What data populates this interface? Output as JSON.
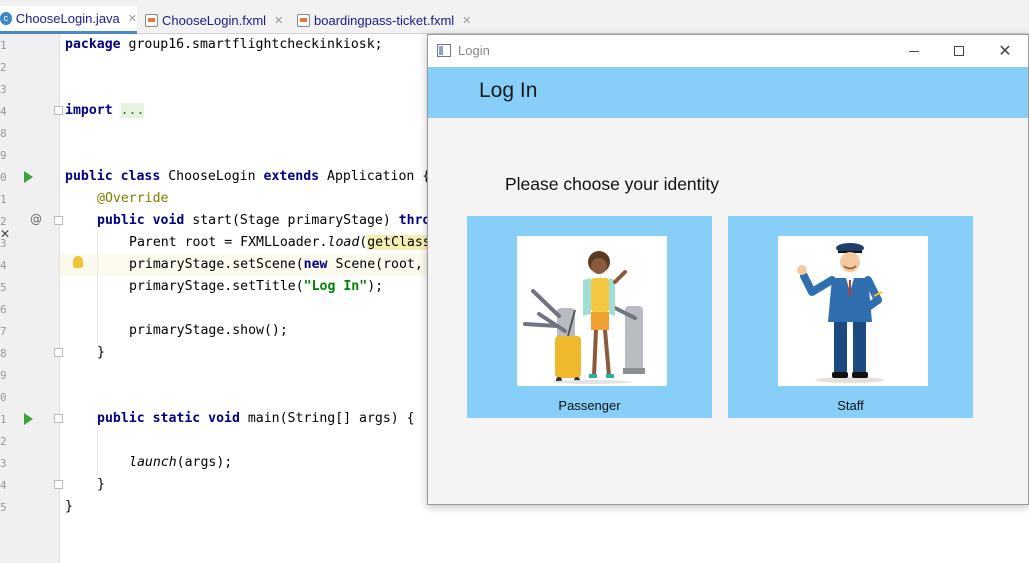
{
  "editor": {
    "tabs": [
      {
        "label": "ChooseLogin.java",
        "icon": "java-file-icon",
        "active": true
      },
      {
        "label": "ChooseLogin.fxml",
        "icon": "fxml-file-icon",
        "active": false
      },
      {
        "label": "boardingpass-ticket.fxml",
        "icon": "fxml-file-icon",
        "active": false
      }
    ],
    "line_numbers": [
      "1",
      "2",
      "3",
      "4",
      "8",
      "9",
      "0",
      "1",
      "2",
      "3",
      "4",
      "5",
      "6",
      "7",
      "8",
      "9",
      "0",
      "1",
      "2",
      "3",
      "4",
      "5"
    ],
    "code": {
      "package_kw": "package",
      "package_name": " group16.smartflightcheckinkiosk;",
      "import_kw": "import",
      "import_fold": "...",
      "class_line_kw1": "public class",
      "class_name": " ChooseLogin ",
      "class_extends": "extends",
      "class_rest": " Application {",
      "override": "@Override",
      "start_kw": "public void",
      "start_sig": " start(Stage primaryStage) ",
      "start_throws": "thro",
      "root_line_a": "Parent root = FXMLLoader.",
      "root_line_load": "load",
      "root_line_b": "(",
      "root_line_hl": "getClass",
      "scene_line_a": "primaryStage.setScene(",
      "scene_new": "new",
      "scene_line_b": " Scene(root,",
      "title_line_a": "primaryStage.setTitle(",
      "title_str": "\"Log In\"",
      "title_line_b": ");",
      "show_line": "primaryStage.show();",
      "close_brace_inner": "}",
      "main_kw": "public static void",
      "main_sig": " main(String[] args) {",
      "launch_call": "launch",
      "launch_rest": "(args);",
      "close_brace_main": "}",
      "close_brace_class": "}"
    }
  },
  "login_window": {
    "title": "Login",
    "header_title": "Log In",
    "prompt": "Please choose your identity",
    "options": [
      {
        "label": "Passenger",
        "image": "passenger-illustration"
      },
      {
        "label": "Staff",
        "image": "staff-illustration"
      }
    ],
    "colors": {
      "header": "#87cef8",
      "card": "#87cef8",
      "window_bg": "#f4f4f4"
    }
  }
}
